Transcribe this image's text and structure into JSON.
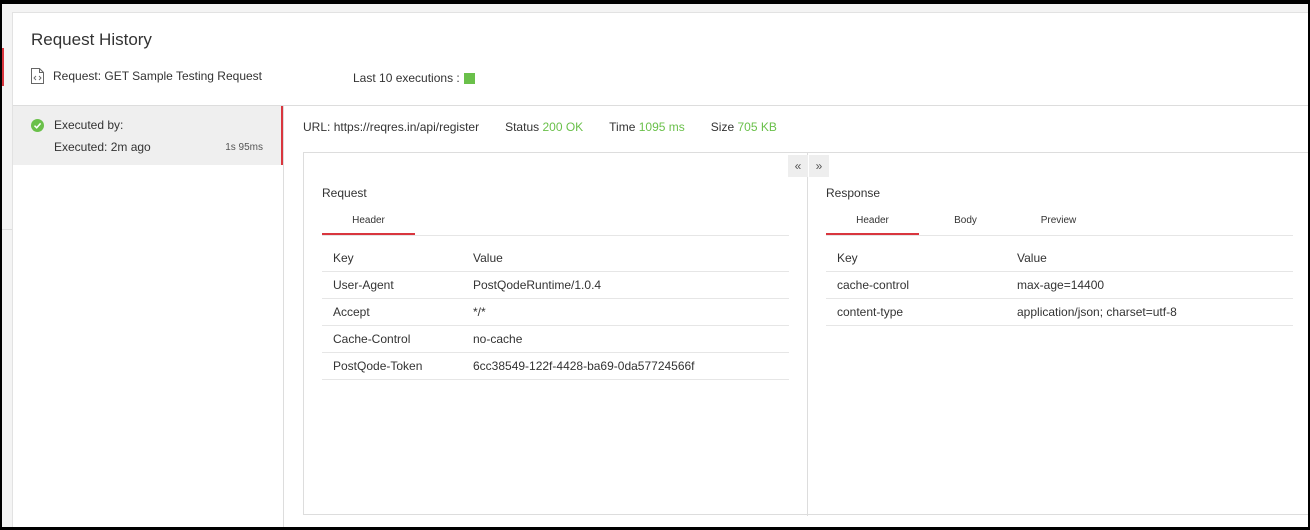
{
  "modal": {
    "title": "Request History",
    "request_label": "Request: GET Sample Testing Request",
    "last_executions_label": "Last 10 executions :",
    "execution_status_color": "#6ac04a"
  },
  "history": [
    {
      "executed_by": "Executed by:",
      "executed_ago": "Executed: 2m ago",
      "duration": "1s 95ms",
      "status_icon": "check-circle-icon"
    }
  ],
  "summary": {
    "url_label": "URL:",
    "url": "https://reqres.in/api/register",
    "status_label": "Status",
    "status": "200 OK",
    "time_label": "Time",
    "time": "1095 ms",
    "size_label": "Size",
    "size": "705 KB"
  },
  "collapse_left": "«",
  "expand_right": "»",
  "request": {
    "title": "Request",
    "tabs": [
      "Header"
    ],
    "active_tab": "Header",
    "columns": [
      "Key",
      "Value"
    ],
    "rows": [
      [
        "User-Agent",
        "PostQodeRuntime/1.0.4"
      ],
      [
        "Accept",
        "*/*"
      ],
      [
        "Cache-Control",
        "no-cache"
      ],
      [
        "PostQode-Token",
        "6cc38549-122f-4428-ba69-0da57724566f"
      ]
    ]
  },
  "response": {
    "title": "Response",
    "tabs": [
      "Header",
      "Body",
      "Preview"
    ],
    "active_tab": "Header",
    "columns": [
      "Key",
      "Value"
    ],
    "rows": [
      [
        "cache-control",
        "max-age=14400"
      ],
      [
        "content-type",
        "application/json; charset=utf-8"
      ]
    ]
  },
  "colors": {
    "accent": "#d9363e",
    "success": "#6ac04a"
  }
}
